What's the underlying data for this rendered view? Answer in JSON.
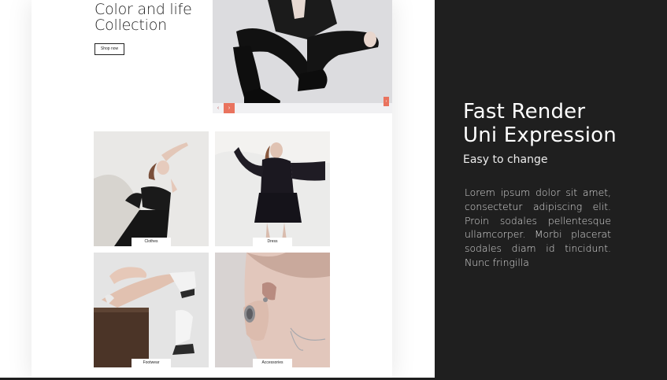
{
  "hero": {
    "title": "Color and life\nCollection",
    "shop_label": "Shop now",
    "prev_arrow": "‹",
    "next_arrow": "›",
    "side_tag": "›"
  },
  "categories": [
    {
      "label": "Clothes"
    },
    {
      "label": "Dress"
    },
    {
      "label": "Footwear"
    },
    {
      "label": "Accessories"
    }
  ],
  "panel": {
    "title": "Fast Render\nUni Expression",
    "subtitle": "Easy to change",
    "body": "Lorem ipsum dolor sit amet, consectetur adipiscing elit. Proin sodales pellentesque ullamcorper. Morbi placerat sodales diam id tincidunt. Nunc fringilla"
  },
  "colors": {
    "panel_bg": "#1f1f1f",
    "accent": "#e9735e",
    "text_dark": "#1d1d1d"
  }
}
